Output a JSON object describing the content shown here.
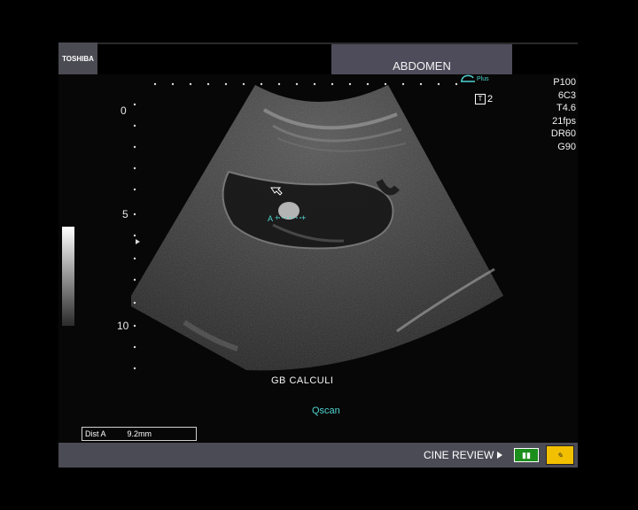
{
  "header": {
    "brand": "TOSHIBA",
    "exam_preset": "ABDOMEN"
  },
  "params": [
    "P100",
    "6C3",
    "T4.6",
    "21fps",
    "DR60",
    "G90"
  ],
  "probe_indicator": "Plus",
  "transmit": {
    "icon_label": "T",
    "value": "2"
  },
  "depth_scale": {
    "labels": [
      "0",
      "5",
      "10"
    ]
  },
  "image": {
    "caption": "GB CALCULI",
    "caliper_label": "A"
  },
  "status": {
    "scan_mode": "Qscan"
  },
  "measurement": {
    "label": "Dist A",
    "value": "9.2mm"
  },
  "footer": {
    "cine_label": "CINE REVIEW"
  },
  "colors": {
    "cyan": "#4fd3d0",
    "preset_bar": "#4e4c5a",
    "footer_bar": "#4b4b55",
    "indicator_green": "#1c8e1c",
    "indicator_yellow": "#f2c000"
  }
}
